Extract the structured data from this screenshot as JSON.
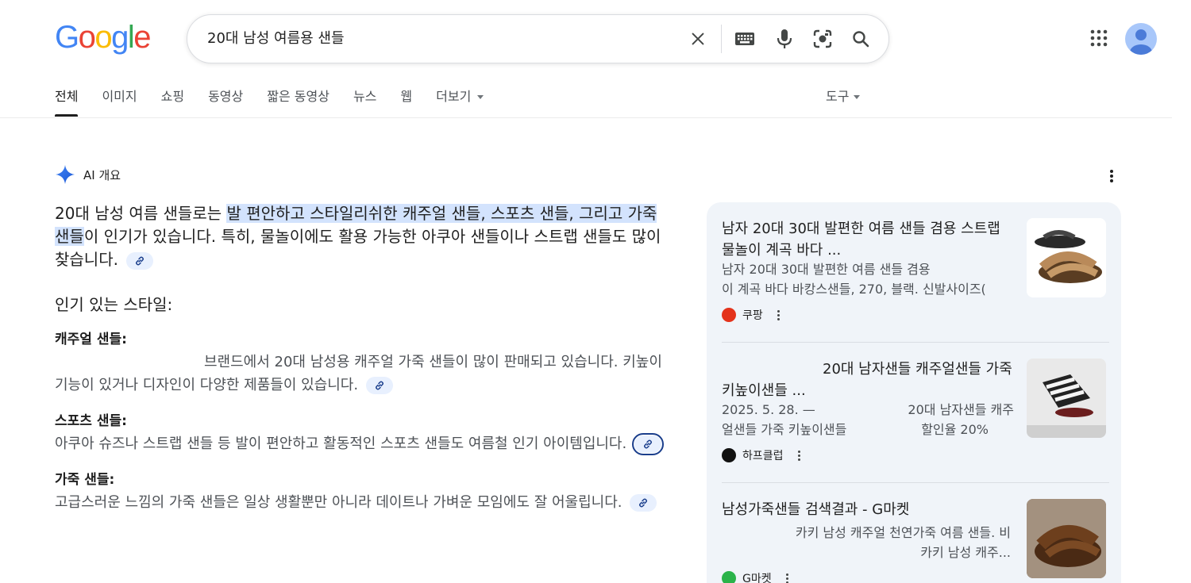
{
  "logo": {
    "letters": [
      "G",
      "o",
      "o",
      "g",
      "l",
      "e"
    ],
    "colors": [
      "#4285F4",
      "#EA4335",
      "#FBBC05",
      "#4285F4",
      "#34A853",
      "#EA4335"
    ]
  },
  "search": {
    "query": "20대 남성 여름용 샌들"
  },
  "tabs": [
    {
      "label": "전체",
      "active": true
    },
    {
      "label": "이미지"
    },
    {
      "label": "쇼핑"
    },
    {
      "label": "동영상"
    },
    {
      "label": "짧은 동영상"
    },
    {
      "label": "뉴스"
    },
    {
      "label": "웹"
    },
    {
      "label": "더보기"
    }
  ],
  "tools_label": "도구",
  "ai": {
    "header": "AI 개요",
    "lead": {
      "pre": "20대 남성 여름 샌들로는 ",
      "highlight": "발 편안하고 스타일리쉬한 캐주얼 샌들, 스포츠 샌들, 그리고 가죽 샌들",
      "post": "이 인기가 있습니다. 특히, 물놀이에도 활용 가능한 아쿠아 샌들이나 스트랩 샌들도 많이 찾습니다."
    },
    "section_title": "인기 있는 스타일:",
    "items": [
      {
        "title": "캐주얼 샌들:",
        "text": "브랜드에서 20대 남성용 캐주얼 가죽 샌들이 많이 판매되고 있습니다. 키높이 기능이 있거나 디자인이 다양한 제품들이 있습니다."
      },
      {
        "title": "스포츠 샌들:",
        "text": "아쿠아 슈즈나 스트랩 샌들 등 발이 편안하고 활동적인 스포츠 샌들도 여름철 인기 아이템입니다."
      },
      {
        "title": "가죽 샌들:",
        "text": "고급스러운 느낌의 가죽 샌들은 일상 생활뿐만 아니라 데이트나 가벼운 모임에도 잘 어울립니다."
      }
    ]
  },
  "sources": [
    {
      "title": "남자 20대 30대 발편한 여름 샌들 겸용 스트랩 물놀이 계곡 바다 ...",
      "desc_line1": "남자 20대 30대 발편한 여름 샌들 겸용",
      "desc_line2": "이 계곡 바다 바캉스샌들, 270, 블랙. 신발사이즈(",
      "site": "쿠팡",
      "favicon_color": "#e4331b"
    },
    {
      "title": "20대 남자샌들 캐주얼샌들 가죽 키높이샌들 ...",
      "date": "2025. 5. 28. —",
      "desc_right": "20대 남자샌들 캐주",
      "desc_line2": "얼샌들 가죽 키높이샌들",
      "desc_line2_right": "할인율 20%",
      "site": "하프클럽",
      "favicon_color": "#111111"
    },
    {
      "title": "남성가죽샌들 검색결과 - G마켓",
      "desc_line1": "카키 남성 캐주얼 천연가죽 여름 샌들. 비",
      "desc_line2": "카키 남성 캐주...",
      "site": "G마켓",
      "favicon_color": "#2bb34a"
    }
  ]
}
